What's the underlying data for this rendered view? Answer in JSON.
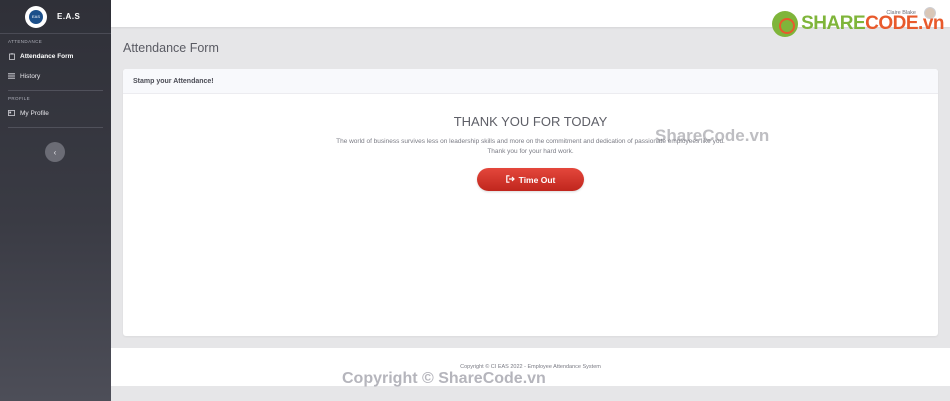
{
  "brand": {
    "name": "E.A.S",
    "logo_text": "EAS"
  },
  "sidebar": {
    "section_attendance": "ATTENDANCE",
    "section_profile": "PROFILE",
    "items": [
      {
        "label": "Attendance Form",
        "icon": "clipboard-icon"
      },
      {
        "label": "History",
        "icon": "list-icon"
      },
      {
        "label": "My Profile",
        "icon": "id-card-icon"
      }
    ],
    "collapse_glyph": "‹"
  },
  "topbar": {
    "user_name": "Claire Blake"
  },
  "page": {
    "title": "Attendance Form"
  },
  "card": {
    "header": "Stamp your Attendance!",
    "thanks_title": "THANK YOU FOR TODAY",
    "thanks_line1": "The world of business survives less on leadership skills and more on the commitment and dedication of passionate employees like you.",
    "thanks_line2": "Thank you for your hard work.",
    "button_label": "Time Out",
    "button_icon": "sign-out-icon"
  },
  "footer": {
    "text": "Copyright © CI EAS 2022 - Employee Attendance System"
  },
  "watermarks": {
    "logo_share": "SHARE",
    "logo_code": "CODE.vn",
    "mid": "ShareCode.vn",
    "bottom": "Copyright © ShareCode.vn"
  },
  "colors": {
    "sidebar": "#2f3038",
    "accent_button": "#d9342a",
    "card_header": "#f8f9fc"
  }
}
